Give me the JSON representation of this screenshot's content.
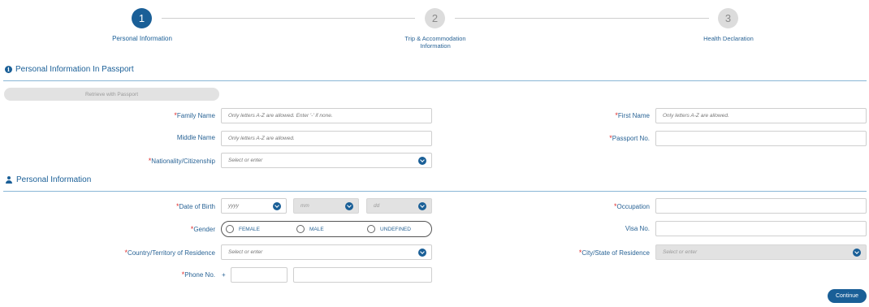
{
  "stepper": {
    "steps": [
      {
        "number": "1",
        "label": "Personal Information"
      },
      {
        "number": "2",
        "label": "Trip & Accommodation Information"
      },
      {
        "number": "3",
        "label": "Health Declaration"
      }
    ]
  },
  "passport_section": {
    "title": "Personal Information In Passport",
    "retrieve_label": "Retrieve with Passport",
    "family_name": {
      "label": "Family Name",
      "placeholder": "Only letters A-Z are allowed. Enter '-' if none."
    },
    "first_name": {
      "label": "First Name",
      "placeholder": "Only letters A-Z are allowed."
    },
    "middle_name": {
      "label": "Middle Name",
      "placeholder": "Only letters A-Z are allowed."
    },
    "passport_no": {
      "label": "Passport No.",
      "placeholder": ""
    },
    "nationality": {
      "label": "Nationality/Citizenship",
      "placeholder": "Select or enter"
    }
  },
  "personal_section": {
    "title": "Personal Information",
    "dob": {
      "label": "Date of Birth",
      "year": "yyyy",
      "month": "mm",
      "day": "dd"
    },
    "occupation": {
      "label": "Occupation"
    },
    "gender": {
      "label": "Gender",
      "options": [
        "FEMALE",
        "MALE",
        "UNDEFINED"
      ]
    },
    "visa_no": {
      "label": "Visa No."
    },
    "country": {
      "label": "Country/Territory of Residence",
      "placeholder": "Select or enter"
    },
    "city": {
      "label": "City/State of Residence",
      "placeholder": "Select or enter"
    },
    "phone": {
      "label": "Phone No.",
      "prefix": "+"
    }
  },
  "continue_label": "Continue",
  "required_mark": "*"
}
